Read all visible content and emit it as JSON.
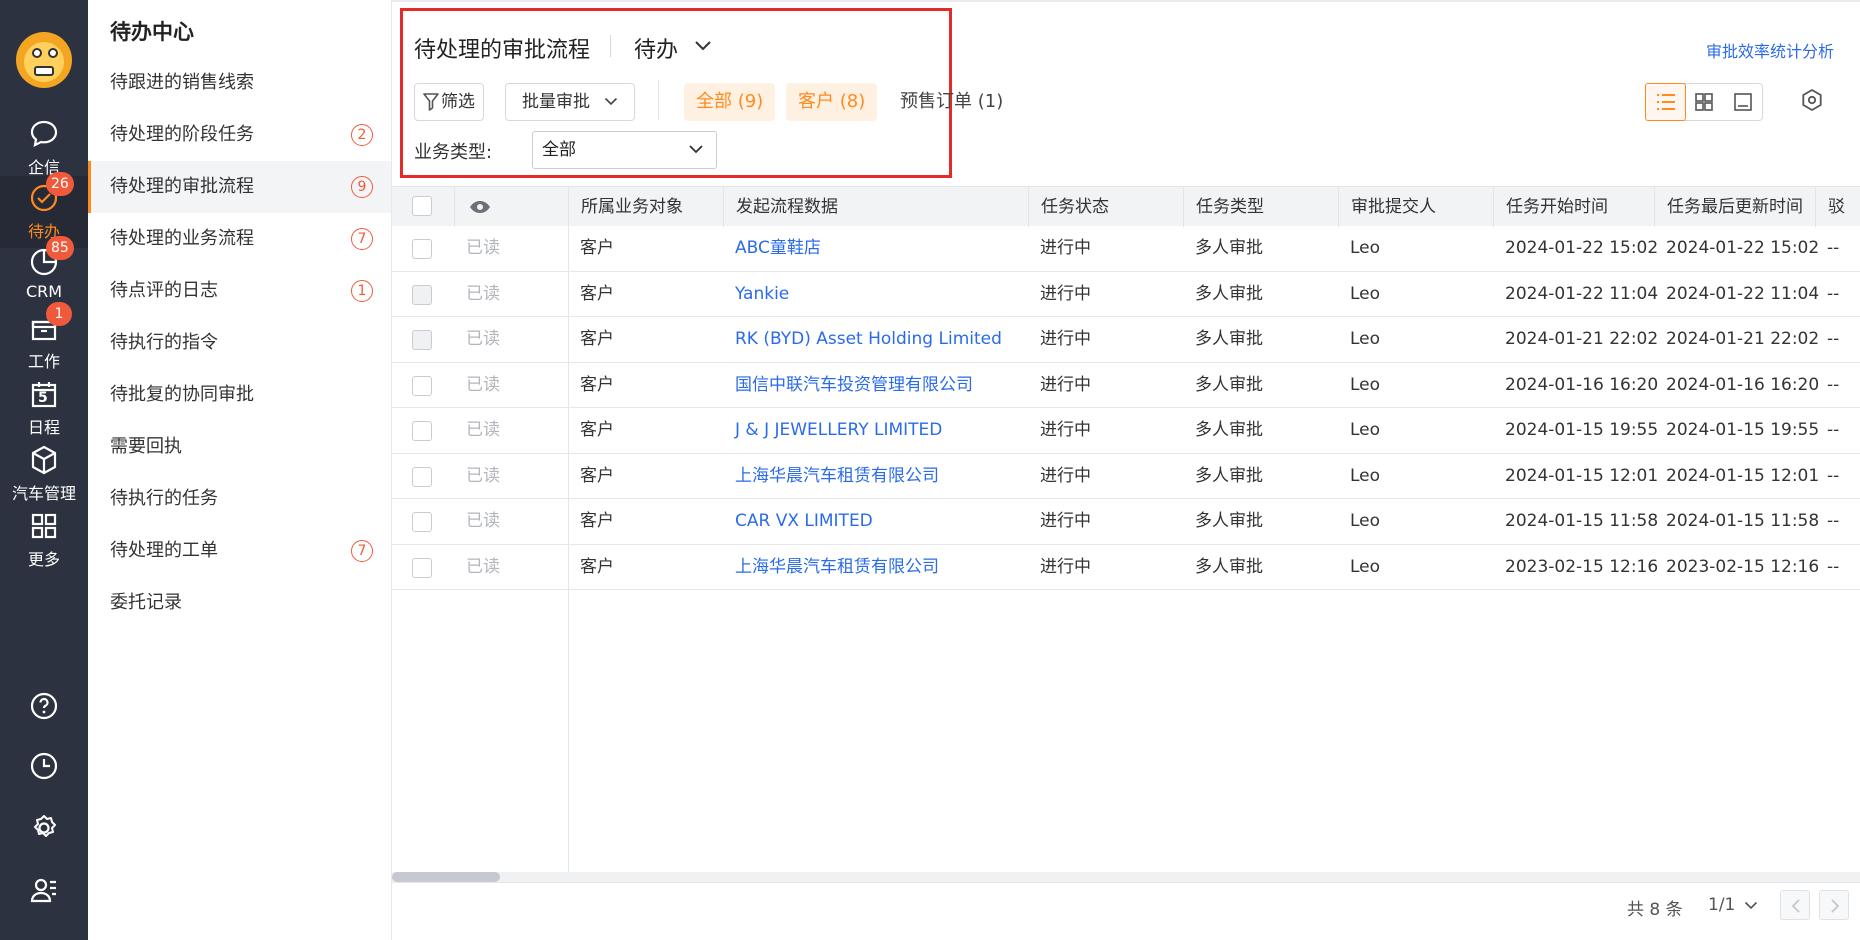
{
  "rail": {
    "items": [
      {
        "label": "企信",
        "icon": "chat-icon"
      },
      {
        "label": "待办",
        "icon": "check-circle-icon",
        "badge": "26"
      },
      {
        "label": "CRM",
        "icon": "pie-clock-icon",
        "badge": "85"
      },
      {
        "label": "工作",
        "icon": "briefcase-icon",
        "badge": "1"
      },
      {
        "label": "日程",
        "icon": "calendar-icon",
        "day": "5"
      },
      {
        "label": "汽车管理",
        "icon": "cube-icon"
      },
      {
        "label": "更多",
        "icon": "grid-icon"
      }
    ],
    "bottom_icons": [
      "help-icon",
      "clock-icon",
      "gear-icon",
      "user-list-icon"
    ]
  },
  "menu": {
    "title": "待办中心",
    "items": [
      {
        "label": "待跟进的销售线索",
        "count": ""
      },
      {
        "label": "待处理的阶段任务",
        "count": "2"
      },
      {
        "label": "待处理的审批流程",
        "count": "9"
      },
      {
        "label": "待处理的业务流程",
        "count": "7"
      },
      {
        "label": "待点评的日志",
        "count": "1"
      },
      {
        "label": "待执行的指令",
        "count": ""
      },
      {
        "label": "待批复的协同审批",
        "count": ""
      },
      {
        "label": "需要回执",
        "count": ""
      },
      {
        "label": "待执行的任务",
        "count": ""
      },
      {
        "label": "待处理的工单",
        "count": "7"
      },
      {
        "label": "委托记录",
        "count": ""
      }
    ]
  },
  "header": {
    "title": "待处理的审批流程",
    "view": "待办",
    "stats_link": "审批效率统计分析"
  },
  "toolbar": {
    "filter_label": "筛选",
    "batch_label": "批量审批",
    "chips": [
      {
        "label": "全部 (9)",
        "active": true
      },
      {
        "label": "客户 (8)",
        "active": true
      },
      {
        "label": "预售订单 (1)",
        "active": false
      }
    ],
    "type_label": "业务类型:",
    "type_value": "全部"
  },
  "table": {
    "columns": [
      "所属业务对象",
      "发起流程数据",
      "任务状态",
      "任务类型",
      "审批提交人",
      "任务开始时间",
      "任务最后更新时间",
      "驳回"
    ],
    "rows": [
      [
        "已读",
        "客户",
        "ABC童鞋店",
        "进行中",
        "多人审批",
        "Leo",
        "2024-01-22 15:02",
        "2024-01-22 15:02",
        "--"
      ],
      [
        "已读",
        "客户",
        "Yankie",
        "进行中",
        "多人审批",
        "Leo",
        "2024-01-22 11:04",
        "2024-01-22 11:04",
        "--"
      ],
      [
        "已读",
        "客户",
        "RK (BYD) Asset Holding Limited",
        "进行中",
        "多人审批",
        "Leo",
        "2024-01-21 22:02",
        "2024-01-21 22:02",
        "--"
      ],
      [
        "已读",
        "客户",
        "国信中联汽车投资管理有限公司",
        "进行中",
        "多人审批",
        "Leo",
        "2024-01-16 16:20",
        "2024-01-16 16:20",
        "--"
      ],
      [
        "已读",
        "客户",
        "J & J JEWELLERY LIMITED",
        "进行中",
        "多人审批",
        "Leo",
        "2024-01-15 19:55",
        "2024-01-15 19:55",
        "--"
      ],
      [
        "已读",
        "客户",
        "上海华晨汽车租赁有限公司",
        "进行中",
        "多人审批",
        "Leo",
        "2024-01-15 12:01",
        "2024-01-15 12:01",
        "--"
      ],
      [
        "已读",
        "客户",
        "CAR VX LIMITED",
        "进行中",
        "多人审批",
        "Leo",
        "2024-01-15 11:58",
        "2024-01-15 11:58",
        "--"
      ],
      [
        "已读",
        "客户",
        "上海华晨汽车租赁有限公司",
        "进行中",
        "多人审批",
        "Leo",
        "2023-02-15 12:16",
        "2023-02-15 12:16",
        "--"
      ]
    ]
  },
  "footer": {
    "total": "共 8 条",
    "pages": "1/1"
  },
  "colors": {
    "accent": "#ff8a1f",
    "link": "#2a6bea",
    "badge": "#f05a3b",
    "rail": "#2c3240",
    "highlight": "#e52a2a"
  }
}
